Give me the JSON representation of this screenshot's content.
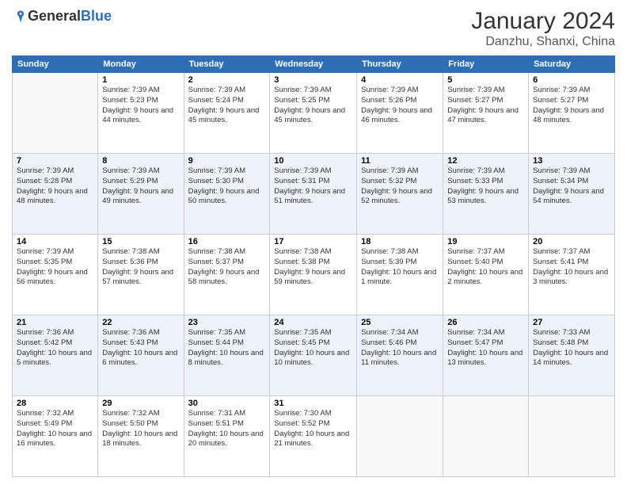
{
  "header": {
    "logo_general": "General",
    "logo_blue": "Blue",
    "month_year": "January 2024",
    "location": "Danzhu, Shanxi, China"
  },
  "days_of_week": [
    "Sunday",
    "Monday",
    "Tuesday",
    "Wednesday",
    "Thursday",
    "Friday",
    "Saturday"
  ],
  "weeks": [
    [
      {
        "day": "",
        "sunrise": "",
        "sunset": "",
        "daylight": ""
      },
      {
        "day": "1",
        "sunrise": "Sunrise: 7:39 AM",
        "sunset": "Sunset: 5:23 PM",
        "daylight": "Daylight: 9 hours and 44 minutes."
      },
      {
        "day": "2",
        "sunrise": "Sunrise: 7:39 AM",
        "sunset": "Sunset: 5:24 PM",
        "daylight": "Daylight: 9 hours and 45 minutes."
      },
      {
        "day": "3",
        "sunrise": "Sunrise: 7:39 AM",
        "sunset": "Sunset: 5:25 PM",
        "daylight": "Daylight: 9 hours and 45 minutes."
      },
      {
        "day": "4",
        "sunrise": "Sunrise: 7:39 AM",
        "sunset": "Sunset: 5:26 PM",
        "daylight": "Daylight: 9 hours and 46 minutes."
      },
      {
        "day": "5",
        "sunrise": "Sunrise: 7:39 AM",
        "sunset": "Sunset: 5:27 PM",
        "daylight": "Daylight: 9 hours and 47 minutes."
      },
      {
        "day": "6",
        "sunrise": "Sunrise: 7:39 AM",
        "sunset": "Sunset: 5:27 PM",
        "daylight": "Daylight: 9 hours and 48 minutes."
      }
    ],
    [
      {
        "day": "7",
        "sunrise": "Sunrise: 7:39 AM",
        "sunset": "Sunset: 5:28 PM",
        "daylight": "Daylight: 9 hours and 48 minutes."
      },
      {
        "day": "8",
        "sunrise": "Sunrise: 7:39 AM",
        "sunset": "Sunset: 5:29 PM",
        "daylight": "Daylight: 9 hours and 49 minutes."
      },
      {
        "day": "9",
        "sunrise": "Sunrise: 7:39 AM",
        "sunset": "Sunset: 5:30 PM",
        "daylight": "Daylight: 9 hours and 50 minutes."
      },
      {
        "day": "10",
        "sunrise": "Sunrise: 7:39 AM",
        "sunset": "Sunset: 5:31 PM",
        "daylight": "Daylight: 9 hours and 51 minutes."
      },
      {
        "day": "11",
        "sunrise": "Sunrise: 7:39 AM",
        "sunset": "Sunset: 5:32 PM",
        "daylight": "Daylight: 9 hours and 52 minutes."
      },
      {
        "day": "12",
        "sunrise": "Sunrise: 7:39 AM",
        "sunset": "Sunset: 5:33 PM",
        "daylight": "Daylight: 9 hours and 53 minutes."
      },
      {
        "day": "13",
        "sunrise": "Sunrise: 7:39 AM",
        "sunset": "Sunset: 5:34 PM",
        "daylight": "Daylight: 9 hours and 54 minutes."
      }
    ],
    [
      {
        "day": "14",
        "sunrise": "Sunrise: 7:39 AM",
        "sunset": "Sunset: 5:35 PM",
        "daylight": "Daylight: 9 hours and 56 minutes."
      },
      {
        "day": "15",
        "sunrise": "Sunrise: 7:38 AM",
        "sunset": "Sunset: 5:36 PM",
        "daylight": "Daylight: 9 hours and 57 minutes."
      },
      {
        "day": "16",
        "sunrise": "Sunrise: 7:38 AM",
        "sunset": "Sunset: 5:37 PM",
        "daylight": "Daylight: 9 hours and 58 minutes."
      },
      {
        "day": "17",
        "sunrise": "Sunrise: 7:38 AM",
        "sunset": "Sunset: 5:38 PM",
        "daylight": "Daylight: 9 hours and 59 minutes."
      },
      {
        "day": "18",
        "sunrise": "Sunrise: 7:38 AM",
        "sunset": "Sunset: 5:39 PM",
        "daylight": "Daylight: 10 hours and 1 minute."
      },
      {
        "day": "19",
        "sunrise": "Sunrise: 7:37 AM",
        "sunset": "Sunset: 5:40 PM",
        "daylight": "Daylight: 10 hours and 2 minutes."
      },
      {
        "day": "20",
        "sunrise": "Sunrise: 7:37 AM",
        "sunset": "Sunset: 5:41 PM",
        "daylight": "Daylight: 10 hours and 3 minutes."
      }
    ],
    [
      {
        "day": "21",
        "sunrise": "Sunrise: 7:36 AM",
        "sunset": "Sunset: 5:42 PM",
        "daylight": "Daylight: 10 hours and 5 minutes."
      },
      {
        "day": "22",
        "sunrise": "Sunrise: 7:36 AM",
        "sunset": "Sunset: 5:43 PM",
        "daylight": "Daylight: 10 hours and 6 minutes."
      },
      {
        "day": "23",
        "sunrise": "Sunrise: 7:35 AM",
        "sunset": "Sunset: 5:44 PM",
        "daylight": "Daylight: 10 hours and 8 minutes."
      },
      {
        "day": "24",
        "sunrise": "Sunrise: 7:35 AM",
        "sunset": "Sunset: 5:45 PM",
        "daylight": "Daylight: 10 hours and 10 minutes."
      },
      {
        "day": "25",
        "sunrise": "Sunrise: 7:34 AM",
        "sunset": "Sunset: 5:46 PM",
        "daylight": "Daylight: 10 hours and 11 minutes."
      },
      {
        "day": "26",
        "sunrise": "Sunrise: 7:34 AM",
        "sunset": "Sunset: 5:47 PM",
        "daylight": "Daylight: 10 hours and 13 minutes."
      },
      {
        "day": "27",
        "sunrise": "Sunrise: 7:33 AM",
        "sunset": "Sunset: 5:48 PM",
        "daylight": "Daylight: 10 hours and 14 minutes."
      }
    ],
    [
      {
        "day": "28",
        "sunrise": "Sunrise: 7:32 AM",
        "sunset": "Sunset: 5:49 PM",
        "daylight": "Daylight: 10 hours and 16 minutes."
      },
      {
        "day": "29",
        "sunrise": "Sunrise: 7:32 AM",
        "sunset": "Sunset: 5:50 PM",
        "daylight": "Daylight: 10 hours and 18 minutes."
      },
      {
        "day": "30",
        "sunrise": "Sunrise: 7:31 AM",
        "sunset": "Sunset: 5:51 PM",
        "daylight": "Daylight: 10 hours and 20 minutes."
      },
      {
        "day": "31",
        "sunrise": "Sunrise: 7:30 AM",
        "sunset": "Sunset: 5:52 PM",
        "daylight": "Daylight: 10 hours and 21 minutes."
      },
      {
        "day": "",
        "sunrise": "",
        "sunset": "",
        "daylight": ""
      },
      {
        "day": "",
        "sunrise": "",
        "sunset": "",
        "daylight": ""
      },
      {
        "day": "",
        "sunrise": "",
        "sunset": "",
        "daylight": ""
      }
    ]
  ]
}
